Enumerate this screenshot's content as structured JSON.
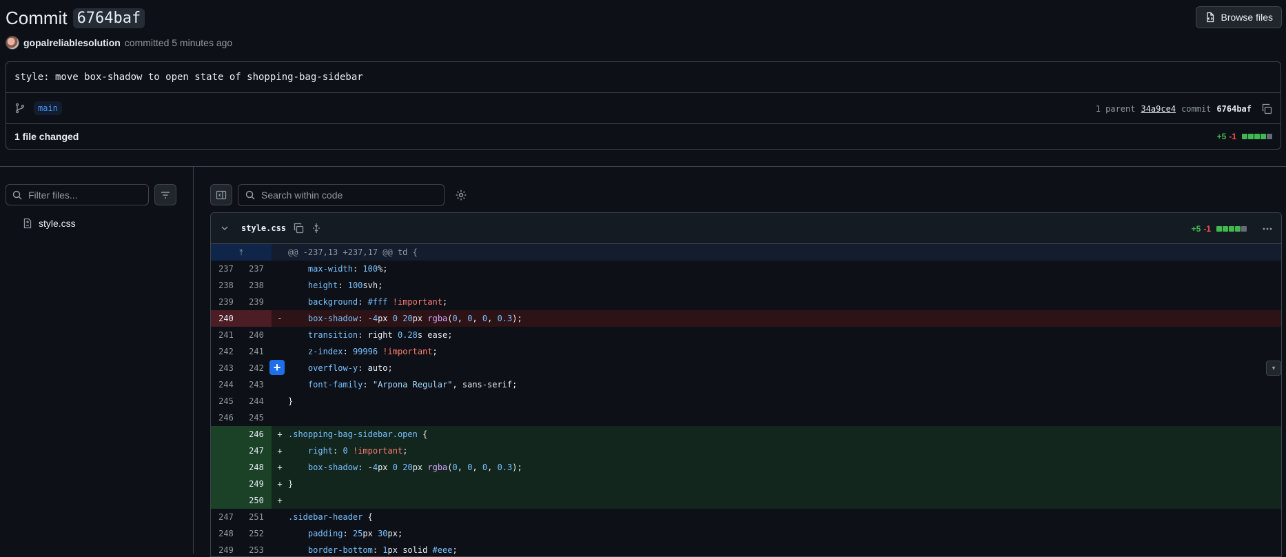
{
  "header": {
    "title": "Commit",
    "sha": "6764baf",
    "browse_files": "Browse files"
  },
  "author": {
    "name": "gopalreliablesolution",
    "action": "committed 5 minutes ago"
  },
  "commit": {
    "message": "style: move box-shadow to open state of shopping-bag-sidebar",
    "branch": "main",
    "parent_label": "1 parent",
    "parent_sha": "34a9ce4",
    "commit_label": "commit",
    "commit_sha": "6764baf",
    "files_changed": "1 file changed",
    "additions": "+5",
    "deletions": "-1"
  },
  "sidebar": {
    "filter_placeholder": "Filter files...",
    "files": [
      "style.css"
    ]
  },
  "toolbar": {
    "search_placeholder": "Search within code"
  },
  "diff": {
    "filename": "style.css",
    "additions": "+5",
    "deletions": "-1",
    "hunk": "@@ -237,13 +237,17 @@ td {",
    "lines": [
      {
        "type": "ctx",
        "old": "237",
        "new": "237",
        "tokens": [
          [
            "",
            "    "
          ],
          [
            "p",
            "max-width"
          ],
          [
            "",
            ": "
          ],
          [
            "n",
            "100"
          ],
          [
            "",
            "%;"
          ]
        ]
      },
      {
        "type": "ctx",
        "old": "238",
        "new": "238",
        "tokens": [
          [
            "",
            "    "
          ],
          [
            "p",
            "height"
          ],
          [
            "",
            ": "
          ],
          [
            "n",
            "100"
          ],
          [
            "",
            "svh;"
          ]
        ]
      },
      {
        "type": "ctx",
        "old": "239",
        "new": "239",
        "tokens": [
          [
            "",
            "    "
          ],
          [
            "p",
            "background"
          ],
          [
            "",
            ": "
          ],
          [
            "n",
            "#fff"
          ],
          [
            "",
            " "
          ],
          [
            "i",
            "!important"
          ],
          [
            "",
            ";"
          ]
        ]
      },
      {
        "type": "del",
        "old": "240",
        "new": "",
        "tokens": [
          [
            "",
            "    "
          ],
          [
            "p",
            "box-shadow"
          ],
          [
            "",
            ": -"
          ],
          [
            "n",
            "4"
          ],
          [
            "",
            "px "
          ],
          [
            "n",
            "0"
          ],
          [
            "",
            " "
          ],
          [
            "n",
            "20"
          ],
          [
            "",
            "px "
          ],
          [
            "f",
            "rgba"
          ],
          [
            "",
            "("
          ],
          [
            "n",
            "0"
          ],
          [
            "",
            ", "
          ],
          [
            "n",
            "0"
          ],
          [
            "",
            ", "
          ],
          [
            "n",
            "0"
          ],
          [
            "",
            ", "
          ],
          [
            "n",
            "0.3"
          ],
          [
            "",
            ");"
          ]
        ]
      },
      {
        "type": "ctx",
        "old": "241",
        "new": "240",
        "tokens": [
          [
            "",
            "    "
          ],
          [
            "p",
            "transition"
          ],
          [
            "",
            ": right "
          ],
          [
            "n",
            "0.28"
          ],
          [
            "",
            "s ease;"
          ]
        ]
      },
      {
        "type": "ctx",
        "old": "242",
        "new": "241",
        "tokens": [
          [
            "",
            "    "
          ],
          [
            "p",
            "z-index"
          ],
          [
            "",
            ": "
          ],
          [
            "n",
            "99996"
          ],
          [
            "",
            " "
          ],
          [
            "i",
            "!important"
          ],
          [
            "",
            ";"
          ]
        ]
      },
      {
        "type": "ctx",
        "old": "243",
        "new": "242",
        "tokens": [
          [
            "",
            "    "
          ],
          [
            "p",
            "overflow-y"
          ],
          [
            "",
            ": auto;"
          ]
        ]
      },
      {
        "type": "ctx",
        "old": "244",
        "new": "243",
        "tokens": [
          [
            "",
            "    "
          ],
          [
            "p",
            "font-family"
          ],
          [
            "",
            ": "
          ],
          [
            "s",
            "\"Arpona Regular\""
          ],
          [
            "",
            ", sans-serif;"
          ]
        ]
      },
      {
        "type": "ctx",
        "old": "245",
        "new": "244",
        "tokens": [
          [
            "",
            "}"
          ]
        ]
      },
      {
        "type": "ctx",
        "old": "246",
        "new": "245",
        "tokens": [
          [
            "",
            ""
          ]
        ]
      },
      {
        "type": "add",
        "old": "",
        "new": "246",
        "tokens": [
          [
            "s2",
            ".shopping-bag-sidebar.open"
          ],
          [
            "",
            " {"
          ]
        ]
      },
      {
        "type": "add",
        "old": "",
        "new": "247",
        "tokens": [
          [
            "",
            "    "
          ],
          [
            "p",
            "right"
          ],
          [
            "",
            ": "
          ],
          [
            "n",
            "0"
          ],
          [
            "",
            " "
          ],
          [
            "i",
            "!important"
          ],
          [
            "",
            ";"
          ]
        ]
      },
      {
        "type": "add",
        "old": "",
        "new": "248",
        "tokens": [
          [
            "",
            "    "
          ],
          [
            "p",
            "box-shadow"
          ],
          [
            "",
            ": -"
          ],
          [
            "n",
            "4"
          ],
          [
            "",
            "px "
          ],
          [
            "n",
            "0"
          ],
          [
            "",
            " "
          ],
          [
            "n",
            "20"
          ],
          [
            "",
            "px "
          ],
          [
            "f",
            "rgba"
          ],
          [
            "",
            "("
          ],
          [
            "n",
            "0"
          ],
          [
            "",
            ", "
          ],
          [
            "n",
            "0"
          ],
          [
            "",
            ", "
          ],
          [
            "n",
            "0"
          ],
          [
            "",
            ", "
          ],
          [
            "n",
            "0.3"
          ],
          [
            "",
            ");"
          ]
        ]
      },
      {
        "type": "add",
        "old": "",
        "new": "249",
        "tokens": [
          [
            "",
            "}"
          ]
        ]
      },
      {
        "type": "add",
        "old": "",
        "new": "250",
        "tokens": [
          [
            "",
            ""
          ]
        ]
      },
      {
        "type": "ctx",
        "old": "247",
        "new": "251",
        "tokens": [
          [
            "s2",
            ".sidebar-header"
          ],
          [
            "",
            " {"
          ]
        ]
      },
      {
        "type": "ctx",
        "old": "248",
        "new": "252",
        "tokens": [
          [
            "",
            "    "
          ],
          [
            "p",
            "padding"
          ],
          [
            "",
            ": "
          ],
          [
            "n",
            "25"
          ],
          [
            "",
            "px "
          ],
          [
            "n",
            "30"
          ],
          [
            "",
            "px;"
          ]
        ]
      },
      {
        "type": "ctx",
        "old": "249",
        "new": "253",
        "tokens": [
          [
            "",
            "    "
          ],
          [
            "p",
            "border-bottom"
          ],
          [
            "",
            ": "
          ],
          [
            "n",
            "1"
          ],
          [
            "",
            "px solid "
          ],
          [
            "n",
            "#eee"
          ],
          [
            "",
            ";"
          ]
        ]
      }
    ]
  }
}
